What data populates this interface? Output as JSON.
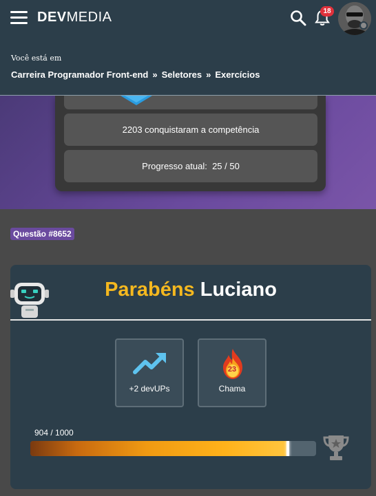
{
  "header": {
    "logo_bold": "DEV",
    "logo_light": "MEDIA",
    "notifications_count": "18",
    "icons": [
      "menu-icon",
      "search-icon",
      "bell-icon",
      "avatar"
    ],
    "you_are_label": "Você está em",
    "breadcrumb": [
      "Carreira Programador Front-end",
      "Seletores",
      "Exercícios"
    ],
    "separator": "»"
  },
  "hero": {
    "achieved_text": "2203 conquistaram a competência",
    "progress_label": "Progresso atual:",
    "progress_value": "25 / 50"
  },
  "question": {
    "tag": "Questão #8652"
  },
  "result": {
    "congrats_word": "Parabéns",
    "user_name": "Luciano",
    "rewards": [
      {
        "icon": "trending-up-icon",
        "label": "+2 devUPs"
      },
      {
        "icon": "flame-icon",
        "value": "23",
        "label": "Chama"
      }
    ],
    "progress_text": "904 / 1000",
    "progress_current": 904,
    "progress_total": 1000,
    "colors": {
      "accent_yellow": "#f5b81f",
      "card_bg": "#2c3e4a",
      "hero_purple": "#6a4a9e"
    }
  }
}
